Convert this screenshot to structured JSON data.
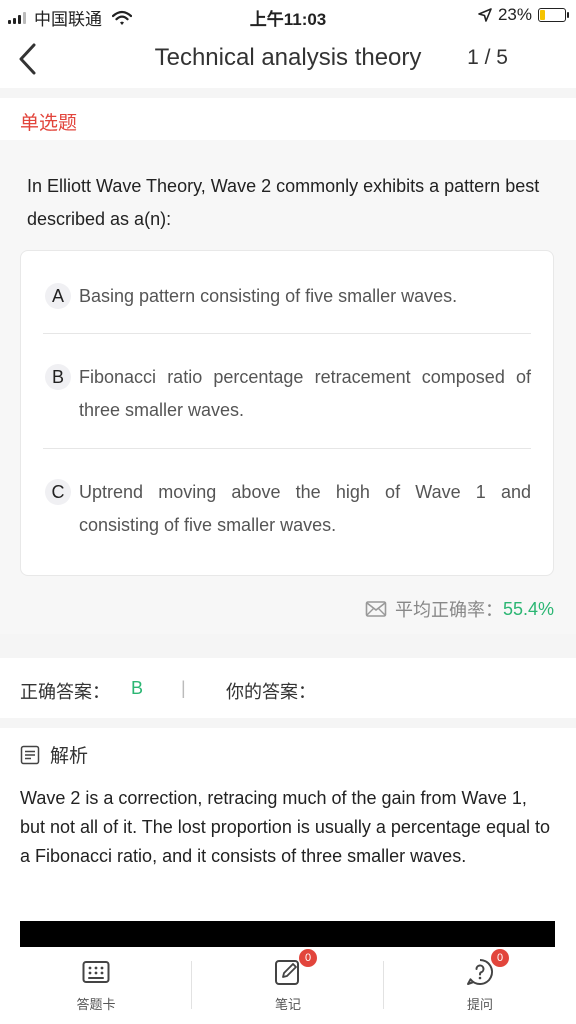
{
  "status_bar": {
    "carrier": "中国联通",
    "time": "上午11:03",
    "battery_percent": "23%",
    "battery_level": 0.23
  },
  "nav": {
    "title": "Technical analysis theory",
    "progress": "1 / 5"
  },
  "question": {
    "type_label": "单选题",
    "text": "In Elliott Wave Theory, Wave 2 commonly exhibits a pattern best described as a(n):",
    "options": [
      {
        "letter": "A",
        "text": "Basing pattern consisting of five smaller waves."
      },
      {
        "letter": "B",
        "text": "Fibonacci ratio percentage retracement composed of three smaller waves."
      },
      {
        "letter": "C",
        "text": "Uptrend moving above the high of Wave 1 and consisting of five smaller waves."
      }
    ]
  },
  "accuracy": {
    "label": "平均正确率：",
    "value": "55.4%"
  },
  "answer": {
    "correct_label": "正确答案：",
    "correct_value": "B",
    "separator": "|",
    "your_label": "你的答案："
  },
  "analysis": {
    "title": "解析",
    "text": "Wave 2 is a correction, retracing much of the gain from Wave 1, but not all of it. The lost proportion is usually a percentage equal to a Fibonacci ratio, and it consists of three smaller waves."
  },
  "tab_bar": {
    "items": [
      {
        "label": "答题卡",
        "icon": "answer-card-icon",
        "badge": ""
      },
      {
        "label": "笔记",
        "icon": "notes-icon",
        "badge": "0"
      },
      {
        "label": "提问",
        "icon": "question-icon",
        "badge": "0"
      }
    ]
  },
  "colors": {
    "accent_red": "#e2453c",
    "accent_green": "#2bb673"
  }
}
